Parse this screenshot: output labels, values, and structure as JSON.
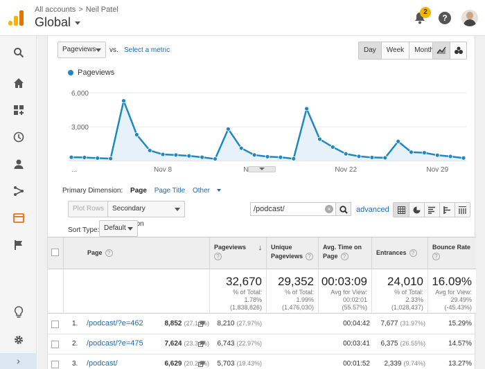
{
  "header": {
    "breadcrumb_root": "All accounts",
    "breadcrumb_sep": ">",
    "breadcrumb_account": "Neil Patel",
    "view_title": "Global",
    "notification_count": "2",
    "help_symbol": "?"
  },
  "sidebar": {
    "items": [
      {
        "icon": "search-icon"
      },
      {
        "icon": "home-icon"
      },
      {
        "icon": "customization-icon"
      },
      {
        "icon": "realtime-clock-icon"
      },
      {
        "icon": "audience-person-icon"
      },
      {
        "icon": "acquisition-icon"
      },
      {
        "icon": "behavior-icon",
        "active": true
      },
      {
        "icon": "conversions-flag-icon"
      },
      {
        "icon": "discover-lightbulb-icon"
      },
      {
        "icon": "admin-gear-icon"
      }
    ],
    "expand_symbol": "›"
  },
  "controls": {
    "metric_select": "Pageviews",
    "vs_label": "vs.",
    "select_metric_link": "Select a metric",
    "period_buttons": [
      "Day",
      "Week",
      "Month"
    ],
    "period_active": "Day",
    "chart_type_buttons": [
      "line-chart-icon",
      "motion-chart-icon"
    ]
  },
  "chart_data": {
    "type": "line",
    "series": [
      {
        "name": "Pageviews",
        "values": [
          300,
          280,
          220,
          180,
          5300,
          2300,
          900,
          550,
          500,
          420,
          300,
          150,
          2800,
          1100,
          500,
          350,
          300,
          170,
          4600,
          1900,
          1200,
          600,
          380,
          280,
          250,
          1700,
          750,
          700,
          480,
          370,
          230
        ]
      }
    ],
    "x_tick_labels": [
      "...",
      "Nov 8",
      "Nov 15",
      "Nov 22",
      "Nov 29"
    ],
    "y_tick_labels": [
      "3,000",
      "6,000"
    ],
    "ylim": [
      0,
      6500
    ],
    "grid": true,
    "legend": "top-left",
    "color": "#1f88c2"
  },
  "dimensions": {
    "label": "Primary Dimension:",
    "options": [
      "Page",
      "Page Title",
      "Other"
    ],
    "active": "Page"
  },
  "toolbar": {
    "plot_rows": "Plot Rows",
    "secondary_dimension": "Secondary dimension",
    "search_value": "/podcast/",
    "clear_symbol": "×",
    "advanced_link": "advanced",
    "sort_type_label": "Sort Type:",
    "sort_type_value": "Default"
  },
  "table": {
    "headers": {
      "page": "Page",
      "pageviews": "Pageviews",
      "unique_pageviews": "Unique Pageviews",
      "avg_time": "Avg. Time on Page",
      "entrances": "Entrances",
      "bounce_rate": "Bounce Rate"
    },
    "totals": {
      "pageviews": {
        "value": "32,670",
        "l1": "% of Total:",
        "l2": "1.78%",
        "l3": "(1,838,826)"
      },
      "unique_pageviews": {
        "value": "29,352",
        "l1": "% of Total:",
        "l2": "1.99%",
        "l3": "(1,476,030)"
      },
      "avg_time": {
        "value": "00:03:09",
        "l1": "Avg for View:",
        "l2": "00:02:01",
        "l3": "(55.57%)"
      },
      "entrances": {
        "value": "24,010",
        "l1": "% of Total:",
        "l2": "2.33%",
        "l3": "(1,028,437)"
      },
      "bounce_rate": {
        "value": "16.09%",
        "l1": "Avg for View:",
        "l2": "29.49%",
        "l3": "(-45.43%)"
      }
    },
    "rows": [
      {
        "index": "1.",
        "page": "/podcast/?e=462",
        "pageviews": "8,852",
        "pageviews_pct": "(27.10%)",
        "unique": "8,210",
        "unique_pct": "(27.97%)",
        "avg_time": "00:04:42",
        "entrances": "7,677",
        "entrances_pct": "(31.97%)",
        "bounce": "15.29%"
      },
      {
        "index": "2.",
        "page": "/podcast/?e=475",
        "pageviews": "7,624",
        "pageviews_pct": "(23.34%)",
        "unique": "6,743",
        "unique_pct": "(22.97%)",
        "avg_time": "00:03:41",
        "entrances": "6,375",
        "entrances_pct": "(26.55%)",
        "bounce": "14.57%"
      },
      {
        "index": "3.",
        "page": "/podcast/",
        "pageviews": "6,629",
        "pageviews_pct": "(20.29%)",
        "unique": "5,703",
        "unique_pct": "(19.43%)",
        "avg_time": "00:01:52",
        "entrances": "2,339",
        "entrances_pct": "(9.74%)",
        "bounce": "13.27%"
      }
    ]
  }
}
